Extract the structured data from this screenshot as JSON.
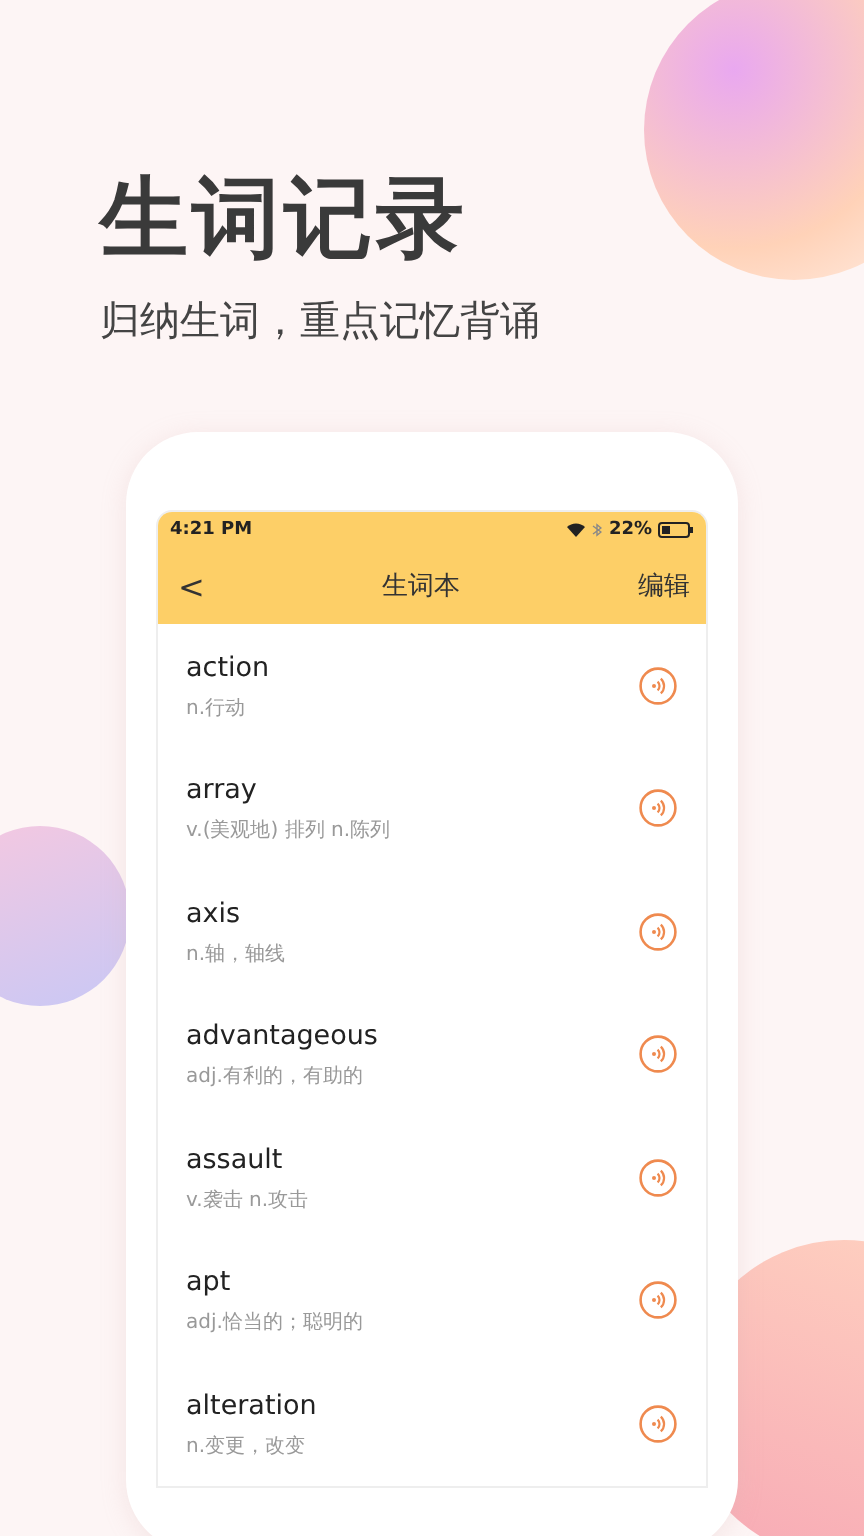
{
  "headline": "生词记录",
  "subtitle": "归纳生词，重点记忆背诵",
  "status_bar": {
    "time": "4:21 PM",
    "battery": "22%"
  },
  "nav": {
    "back": "<",
    "title": "生词本",
    "action": "编辑"
  },
  "words": [
    {
      "word": "action",
      "meaning": "n.行动"
    },
    {
      "word": "array",
      "meaning": "v.(美观地) 排列  n.陈列"
    },
    {
      "word": "axis",
      "meaning": "n.轴，轴线"
    },
    {
      "word": "advantageous",
      "meaning": "adj.有利的，有助的"
    },
    {
      "word": "assault",
      "meaning": "v.袭击 n.攻击"
    },
    {
      "word": "apt",
      "meaning": "adj.恰当的；聪明的"
    },
    {
      "word": "alteration",
      "meaning": "n.变更，改变"
    }
  ]
}
